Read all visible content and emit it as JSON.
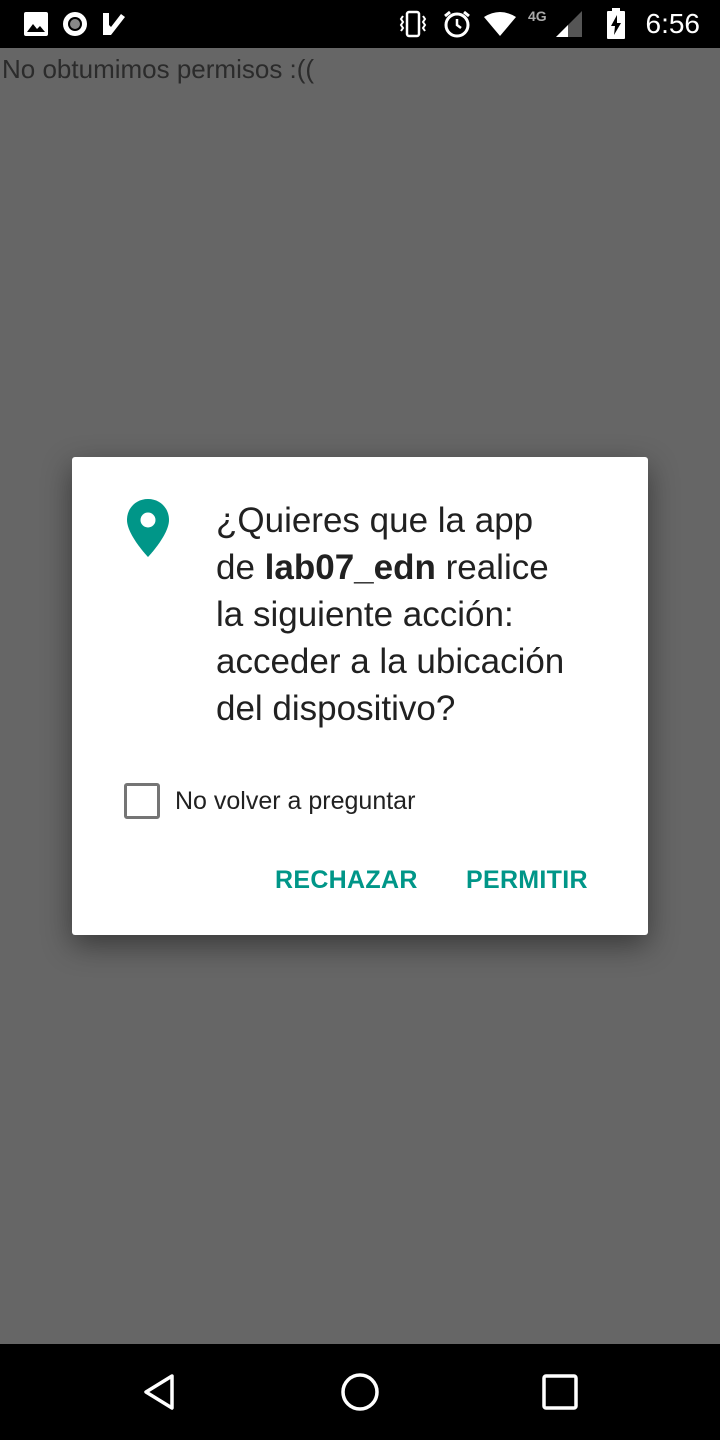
{
  "status_bar": {
    "time": "6:56",
    "network_label": "4G",
    "icons": [
      "image-notification-icon",
      "record-notification-icon",
      "checkmark-notification-icon",
      "vibrate-icon",
      "alarm-icon",
      "wifi-icon",
      "signal-icon",
      "battery-charging-icon"
    ]
  },
  "app": {
    "message": "No obtumimos permisos :(("
  },
  "dialog": {
    "icon": "location-pin-icon",
    "message_line1": "¿Quieres que la app",
    "message_prefix": "de ",
    "app_name": "lab07_edn",
    "message_suffix": " realice",
    "message_line3": "la siguiente acción:",
    "message_line4": "acceder a la ubicación",
    "message_line5": "del dispositivo?",
    "checkbox_label": "No volver a preguntar",
    "checkbox_checked": false,
    "deny_label": "RECHAZAR",
    "allow_label": "PERMITIR",
    "accent_color": "#009688"
  },
  "nav_bar": {
    "icons": [
      "back-icon",
      "home-icon",
      "recents-icon"
    ]
  }
}
